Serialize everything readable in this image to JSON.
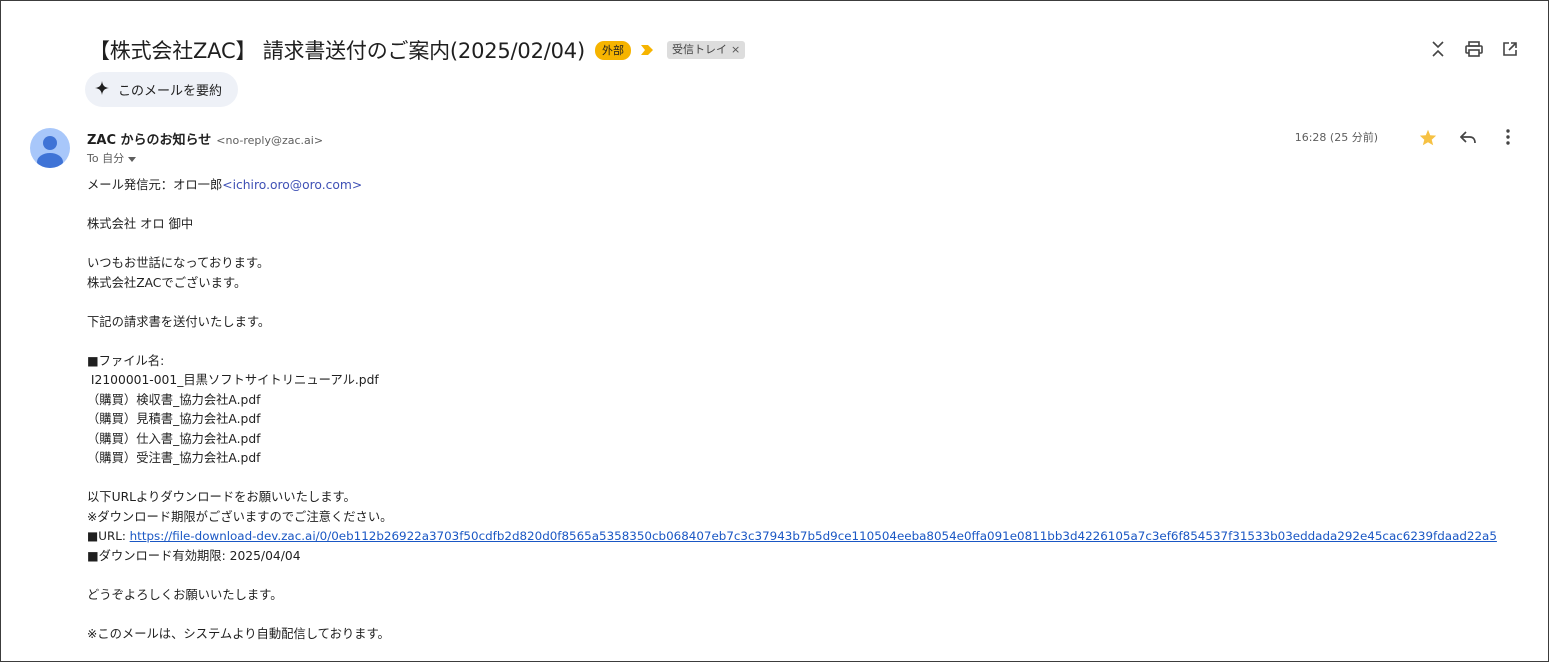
{
  "subject": "【株式会社ZAC】 請求書送付のご案内(2025/02/04)",
  "badges": {
    "external": "外部",
    "inbox_label": "受信トレイ",
    "label_remove": "×"
  },
  "summarize": {
    "label": "このメールを要約"
  },
  "sender": {
    "name": "ZAC からのお知らせ",
    "email": "<no-reply@zac.ai>",
    "to": "To 自分"
  },
  "timestamp": "16:28 (25 分前)",
  "colors": {
    "badge_external": "#f6b400",
    "star": "#f6c143",
    "avatar": "#a8c7fa",
    "link": "#1a57c4"
  },
  "icons": {
    "top": [
      "collapse-icon",
      "print-icon",
      "open-in-new-window-icon"
    ],
    "meta": [
      "star-icon",
      "reply-icon",
      "more-vert-icon"
    ]
  },
  "body": {
    "from_prefix": "メール発信元：オロ一郎",
    "from_email": "<ichiro.oro@oro.com>",
    "addressee": "株式会社 オロ 御中",
    "greeting1": "いつもお世話になっております。",
    "greeting2": "株式会社ZACでございます。",
    "intro": "下記の請求書を送付いたします。",
    "files_header": "■ファイル名:",
    "files": [
      " I2100001-001_目黒ソフトサイトリニューアル.pdf",
      "（購買）検収書_協力会社A.pdf",
      "（購買）見積書_協力会社A.pdf",
      "（購買）仕入書_協力会社A.pdf",
      "（購買）受注書_協力会社A.pdf"
    ],
    "download_intro": "以下URLよりダウンロードをお願いいたします。",
    "download_note": "※ダウンロード期限がございますのでご注意ください。",
    "url_label": "■URL: ",
    "url": "https://file-download-dev.zac.ai/0/0eb112b26922a3703f50cdfb2d820d0f8565a5358350cb068407eb7c3c37943b7b5d9ce110504eeba8054e0ffa091e0811bb3d4226105a7c3ef6f854537f31533b03eddada292e45cac6239fdaad22a5",
    "expiry": "■ダウンロード有効期限: 2025/04/04",
    "closing": "どうぞよろしくお願いいたします。",
    "footer": "※このメールは、システムより自動配信しております。"
  }
}
